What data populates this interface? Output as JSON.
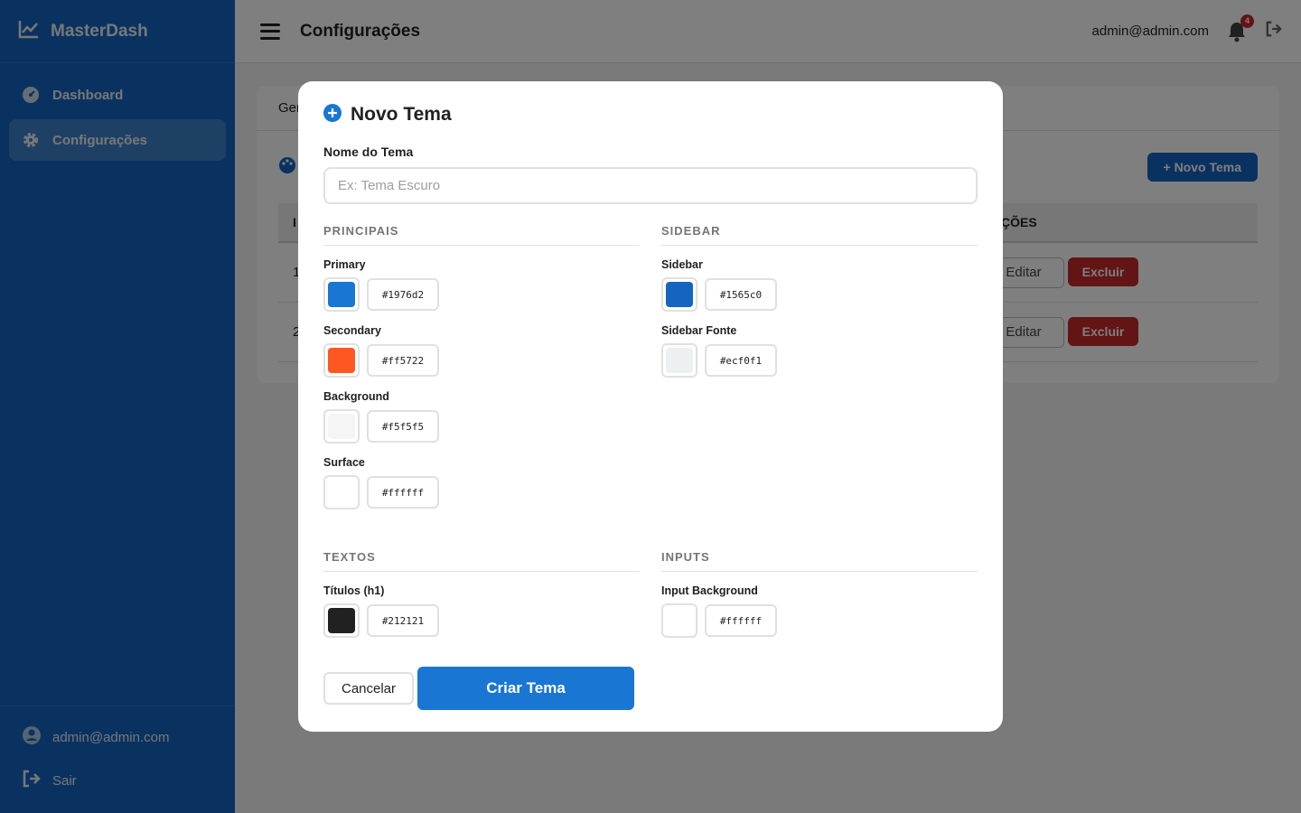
{
  "app": {
    "name": "MasterDash",
    "brand_icon": "line-chart-icon"
  },
  "colors": {
    "sidebar": "#1565c0",
    "primary": "#1976d2",
    "danger": "#c62828"
  },
  "sidebar": {
    "items": [
      {
        "label": "Dashboard",
        "icon": "palette-gauge-icon"
      },
      {
        "label": "Configurações",
        "icon": "gear-icon"
      }
    ],
    "footer": {
      "user": "admin@admin.com",
      "logout": "Sair"
    }
  },
  "header": {
    "title": "Configurações",
    "user_email": "admin@admin.com",
    "notifications": "4"
  },
  "main": {
    "tab_visible": "Ger",
    "new_theme_label": "+ Novo Tema",
    "actions_header": "ÇÕES",
    "id_header": "I",
    "rows": [
      {
        "id": "1",
        "edit": "Editar",
        "delete": "Excluir"
      },
      {
        "id": "2",
        "edit": "Editar",
        "delete": "Excluir"
      }
    ]
  },
  "modal": {
    "title": "Novo Tema",
    "name_label": "Nome do Tema",
    "name_placeholder": "Ex: Tema Escuro",
    "sections": {
      "principais": {
        "title": "PRINCIPAIS",
        "fields": [
          {
            "label": "Primary",
            "value": "#1976d2"
          },
          {
            "label": "Secondary",
            "value": "#ff5722"
          },
          {
            "label": "Background",
            "value": "#f5f5f5"
          },
          {
            "label": "Surface",
            "value": "#ffffff"
          }
        ]
      },
      "sidebar": {
        "title": "SIDEBAR",
        "fields": [
          {
            "label": "Sidebar",
            "value": "#1565c0"
          },
          {
            "label": "Sidebar Fonte",
            "value": "#ecf0f1"
          }
        ]
      },
      "textos": {
        "title": "TEXTOS",
        "fields": [
          {
            "label": "Títulos (h1)",
            "value": "#212121"
          }
        ]
      },
      "inputs": {
        "title": "INPUTS",
        "fields": [
          {
            "label": "Input Background",
            "value": "#ffffff"
          }
        ]
      }
    },
    "cancel_label": "Cancelar",
    "submit_label": "Criar Tema"
  }
}
